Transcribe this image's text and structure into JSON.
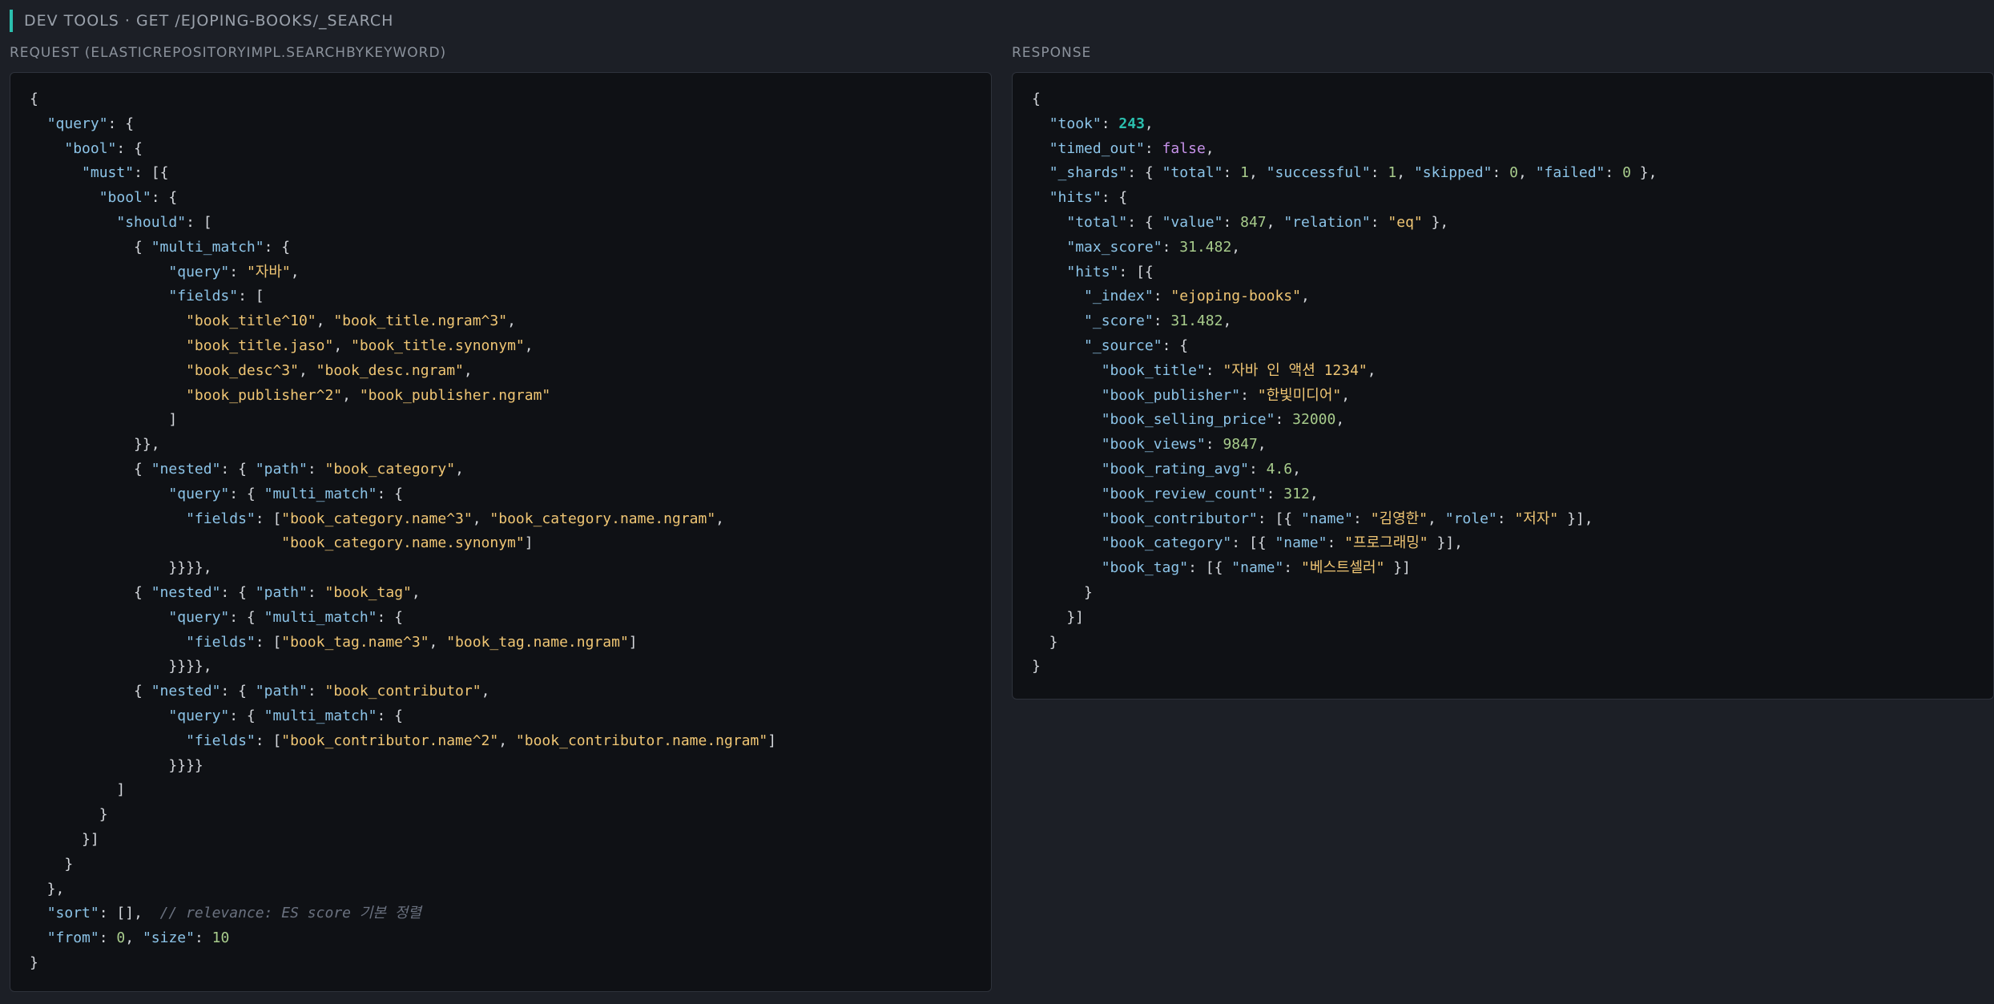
{
  "header": {
    "title": "DEV TOOLS · GET /EJOPING-BOOKS/_SEARCH"
  },
  "request": {
    "label": "REQUEST (ELASTICREPOSITORYIMPL.SEARCHBYKEYWORD)",
    "lines": [
      "{",
      "  \"query\": {",
      "    \"bool\": {",
      "      \"must\": [{",
      "        \"bool\": {",
      "          \"should\": [",
      "            { \"multi_match\": {",
      "                \"query\": \"자바\",",
      "                \"fields\": [",
      "                  \"book_title^10\", \"book_title.ngram^3\",",
      "                  \"book_title.jaso\", \"book_title.synonym\",",
      "                  \"book_desc^3\", \"book_desc.ngram\",",
      "                  \"book_publisher^2\", \"book_publisher.ngram\"",
      "                ]",
      "            }},",
      "            { \"nested\": { \"path\": \"book_category\",",
      "                \"query\": { \"multi_match\": {",
      "                  \"fields\": [\"book_category.name^3\", \"book_category.name.ngram\",",
      "                             \"book_category.name.synonym\"]",
      "                }}}},",
      "            { \"nested\": { \"path\": \"book_tag\",",
      "                \"query\": { \"multi_match\": {",
      "                  \"fields\": [\"book_tag.name^3\", \"book_tag.name.ngram\"]",
      "                }}}},",
      "            { \"nested\": { \"path\": \"book_contributor\",",
      "                \"query\": { \"multi_match\": {",
      "                  \"fields\": [\"book_contributor.name^2\", \"book_contributor.name.ngram\"]",
      "                }}}}",
      "          ]",
      "        }",
      "      }]",
      "    }",
      "  },",
      "  \"sort\": [],  // relevance: ES score 기본 정렬",
      "  \"from\": 0, \"size\": 10",
      "}"
    ]
  },
  "response": {
    "label": "RESPONSE",
    "lines": [
      "{",
      "  \"took\": 243,",
      "  \"timed_out\": false,",
      "  \"_shards\": { \"total\": 1, \"successful\": 1, \"skipped\": 0, \"failed\": 0 },",
      "  \"hits\": {",
      "    \"total\": { \"value\": 847, \"relation\": \"eq\" },",
      "    \"max_score\": 31.482,",
      "    \"hits\": [{",
      "      \"_index\": \"ejoping-books\",",
      "      \"_score\": 31.482,",
      "      \"_source\": {",
      "        \"book_title\": \"자바 인 액션 1234\",",
      "        \"book_publisher\": \"한빛미디어\",",
      "        \"book_selling_price\": 32000,",
      "        \"book_views\": 9847,",
      "        \"book_rating_avg\": 4.6,",
      "        \"book_review_count\": 312,",
      "        \"book_contributor\": [{ \"name\": \"김영한\", \"role\": \"저자\" }],",
      "        \"book_category\": [{ \"name\": \"프로그래밍\" }],",
      "        \"book_tag\": [{ \"name\": \"베스트셀러\" }]",
      "      }",
      "    }]",
      "  }",
      "}"
    ]
  },
  "colors": {
    "accent": "#2bbfae",
    "key": "#8cc4e8",
    "string": "#f0c674",
    "number": "#a8cc8c",
    "boolean": "#c792ea",
    "comment": "#6b7280"
  }
}
